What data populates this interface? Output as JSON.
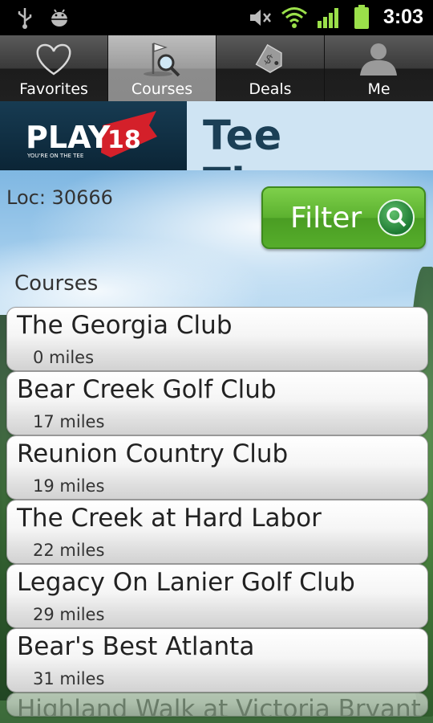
{
  "status_bar": {
    "time": "3:03",
    "icons": [
      "usb-icon",
      "android-debug-icon",
      "mute-icon",
      "wifi-icon",
      "signal-icon",
      "battery-icon"
    ]
  },
  "tabs": [
    {
      "label": "Favorites",
      "icon": "heart-icon",
      "active": false
    },
    {
      "label": "Courses",
      "icon": "golf-flag-search-icon",
      "active": true
    },
    {
      "label": "Deals",
      "icon": "price-tag-icon",
      "active": false
    },
    {
      "label": "Me",
      "icon": "person-icon",
      "active": false
    }
  ],
  "header": {
    "logo_text": "PLAY",
    "logo_number": "18",
    "logo_tagline": "YOU'RE ON THE TEE",
    "title": "Tee Times"
  },
  "location": "Loc: 30666",
  "filter": {
    "label": "Filter",
    "icon": "search-icon"
  },
  "courses_label": "Courses",
  "courses": [
    {
      "name": "The Georgia Club",
      "distance": "0 miles"
    },
    {
      "name": "Bear Creek Golf Club",
      "distance": "17 miles"
    },
    {
      "name": "Reunion Country Club",
      "distance": "19 miles"
    },
    {
      "name": "The Creek at Hard Labor",
      "distance": "22 miles"
    },
    {
      "name": "Legacy On Lanier Golf Club",
      "distance": "29 miles"
    },
    {
      "name": "Bear's Best Atlanta",
      "distance": "31 miles"
    },
    {
      "name": "Highland Walk at Victoria Bryant",
      "distance": ""
    }
  ],
  "colors": {
    "filter_green": "#5cb12f",
    "header_dark": "#0f3044",
    "title_bg": "#cfe4f3",
    "title_text": "#1b3f56",
    "logo_red": "#d4202a"
  }
}
